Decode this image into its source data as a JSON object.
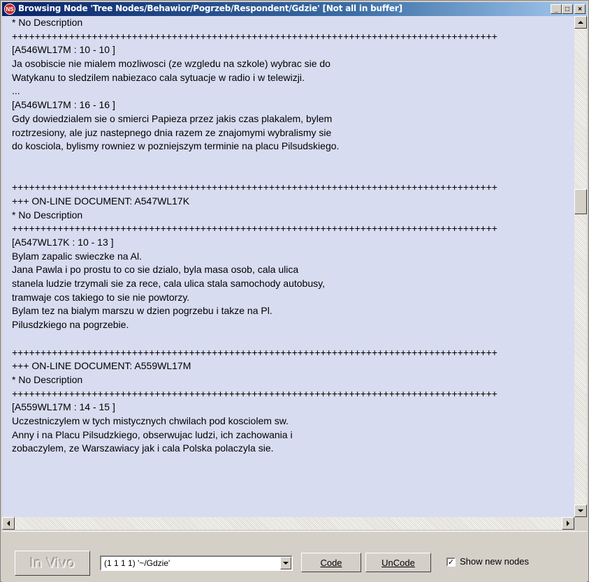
{
  "window": {
    "title": "Browsing Node 'Tree Nodes/Behawior/Pogrzeb/Respondent/Gdzie' [Not all in buffer]",
    "app_icon_text": "NS",
    "minimize_glyph": "_",
    "maximize_glyph": "□",
    "close_glyph": "×"
  },
  "document": {
    "lines": [
      "* No Description",
      "+++++++++++++++++++++++++++++++++++++++++++++++++++++++++++++++++++++++++++++++++++++",
      "[A546WL17M : 10 - 10 ]",
      "Ja osobiscie nie mialem mozliwosci (ze wzgledu na szkole) wybrac sie do",
      "Watykanu to sledzilem nabiezaco cala sytuacje w radio i w telewizji.",
      "...",
      "[A546WL17M : 16 - 16 ]",
      "Gdy dowiedzialem sie o smierci Papieza przez jakis czas plakalem, bylem",
      "roztrzesiony, ale juz nastepnego dnia razem ze znajomymi wybralismy sie",
      "do kosciola, bylismy rowniez w pozniejszym terminie na placu Pilsudskiego.",
      "",
      "",
      "+++++++++++++++++++++++++++++++++++++++++++++++++++++++++++++++++++++++++++++++++++++",
      "+++ ON-LINE DOCUMENT: A547WL17K",
      "* No Description",
      "+++++++++++++++++++++++++++++++++++++++++++++++++++++++++++++++++++++++++++++++++++++",
      "[A547WL17K : 10 - 13 ]",
      "Bylam zapalic swieczke na Al.",
      "Jana Pawla i po prostu to co sie dzialo, byla masa osob, cala ulica",
      "stanela ludzie trzymali sie za rece, cala ulica stala samochody autobusy,",
      "tramwaje cos takiego to sie nie powtorzy.",
      "Bylam tez na bialym marszu w dzien pogrzebu i takze na Pl.",
      "Pilusdzkiego na pogrzebie.",
      "",
      "+++++++++++++++++++++++++++++++++++++++++++++++++++++++++++++++++++++++++++++++++++++",
      "+++ ON-LINE DOCUMENT: A559WL17M",
      "* No Description",
      "+++++++++++++++++++++++++++++++++++++++++++++++++++++++++++++++++++++++++++++++++++++",
      "[A559WL17M : 14 - 15 ]",
      "Uczestniczylem w tych mistycznych chwilach pod kosciolem sw.",
      "Anny i na Placu Pilsudzkiego, obserwujac ludzi, ich zachowania i",
      "zobaczylem, ze Warszawiacy jak i cala Polska polaczyla sie."
    ]
  },
  "toolbar": {
    "invivo_label": "In Vivo",
    "node_combo_value": "(1 1 1 1) '~/Gdzie'",
    "code_label": "Code",
    "uncode_label": "UnCode",
    "show_new_nodes_label": "Show new nodes",
    "show_new_nodes_checked": true,
    "check_glyph": "✓"
  }
}
